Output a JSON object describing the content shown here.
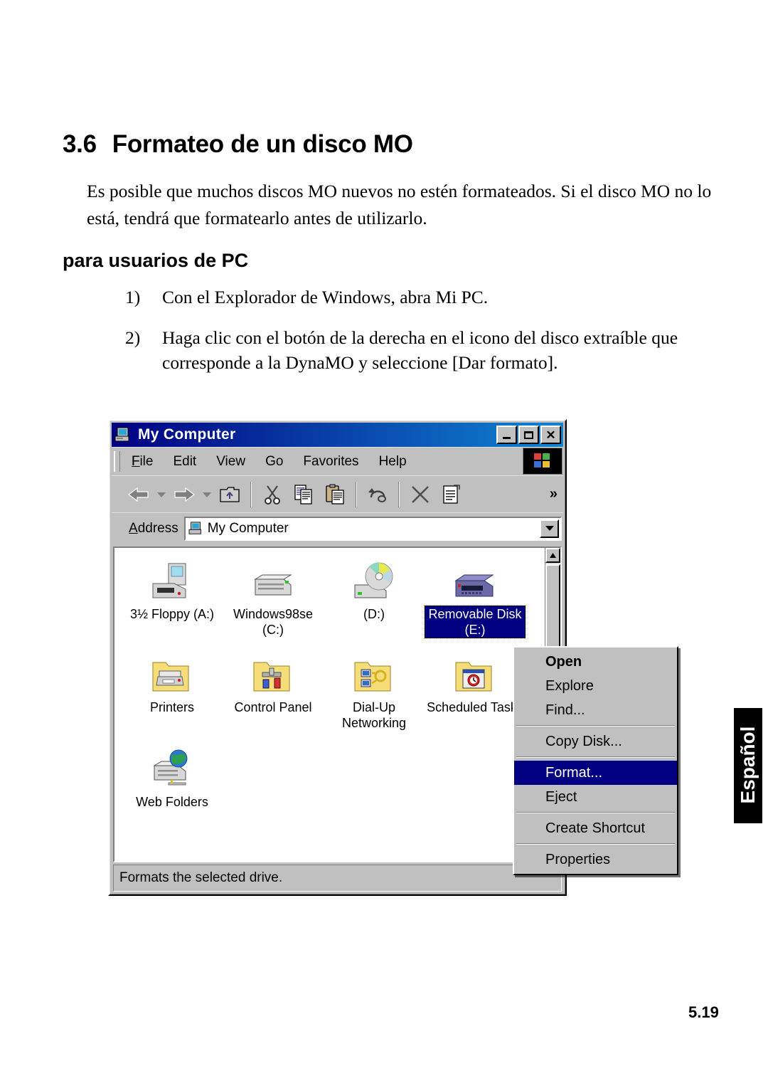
{
  "document": {
    "section_number": "3.6",
    "section_title": "Formateo de un disco MO",
    "intro_paragraph": "Es posible que muchos discos MO nuevos no estén formateados. Si el disco MO no lo está, tendrá que formatearlo antes de utilizarlo.",
    "subheading": "para usuarios de PC",
    "steps": [
      {
        "marker": "1)",
        "text": "Con el Explorador de Windows, abra Mi PC."
      },
      {
        "marker": "2)",
        "text": "Haga clic con el botón de la derecha en el icono del disco extraíble que corresponde a la DynaMO y seleccione [Dar formato]."
      }
    ],
    "language_tab": "Español",
    "page_number": "5.19"
  },
  "window": {
    "title": "My Computer",
    "title_icon": "my-computer-icon",
    "titlebar_buttons": [
      {
        "name": "minimize-button",
        "label": "_"
      },
      {
        "name": "maximize-button",
        "label": "□"
      },
      {
        "name": "close-button",
        "label": "✕"
      }
    ],
    "menu": [
      {
        "label": "File",
        "accel": "F"
      },
      {
        "label": "Edit",
        "accel": "E"
      },
      {
        "label": "View",
        "accel": "V"
      },
      {
        "label": "Go",
        "accel": "G"
      },
      {
        "label": "Favorites",
        "accel": "a"
      },
      {
        "label": "Help",
        "accel": "H"
      }
    ],
    "toolbar": [
      {
        "name": "back-button",
        "icon": "arrow-left-icon"
      },
      {
        "name": "back-dropdown",
        "icon": "caret-down-icon"
      },
      {
        "name": "forward-button",
        "icon": "arrow-right-icon"
      },
      {
        "name": "forward-dropdown",
        "icon": "caret-down-icon"
      },
      {
        "name": "up-button",
        "icon": "folder-up-icon"
      },
      {
        "name": "cut-button",
        "icon": "scissors-icon"
      },
      {
        "name": "copy-button",
        "icon": "copy-icon"
      },
      {
        "name": "paste-button",
        "icon": "clipboard-paste-icon"
      },
      {
        "name": "undo-button",
        "icon": "undo-arrow-icon"
      },
      {
        "name": "delete-button",
        "icon": "x-delete-icon"
      },
      {
        "name": "properties-button",
        "icon": "properties-icon"
      }
    ],
    "toolbar_overflow": "»",
    "address": {
      "label": "Address",
      "value": "My Computer",
      "icon": "my-computer-icon"
    },
    "items": [
      [
        {
          "label": "3½ Floppy (A:)",
          "icon": "floppy-drive-icon",
          "selected": false
        },
        {
          "label": "Windows98se (C:)",
          "icon": "hard-disk-icon",
          "selected": false
        },
        {
          "label": "(D:)",
          "icon": "cd-drive-icon",
          "selected": false
        },
        {
          "label": "Removable Disk (E:)",
          "icon": "removable-disk-icon",
          "selected": true
        }
      ],
      [
        {
          "label": "Printers",
          "icon": "printers-folder-icon",
          "selected": false
        },
        {
          "label": "Control Panel",
          "icon": "control-panel-folder-icon",
          "selected": false
        },
        {
          "label": "Dial-Up Networking",
          "icon": "dialup-folder-icon",
          "selected": false
        },
        {
          "label": "Scheduled Tasks",
          "icon": "scheduled-tasks-folder-icon",
          "selected": false
        }
      ],
      [
        {
          "label": "Web Folders",
          "icon": "web-folders-icon",
          "selected": false
        }
      ]
    ],
    "statusbar": "Formats the selected drive."
  },
  "context_menu": [
    {
      "label": "Open",
      "type": "item",
      "bold": true,
      "selected": false
    },
    {
      "label": "Explore",
      "type": "item",
      "bold": false,
      "selected": false
    },
    {
      "label": "Find...",
      "type": "item",
      "bold": false,
      "selected": false
    },
    {
      "label": "",
      "type": "separator"
    },
    {
      "label": "Copy Disk...",
      "type": "item",
      "bold": false,
      "selected": false
    },
    {
      "label": "",
      "type": "separator"
    },
    {
      "label": "Format...",
      "type": "item",
      "bold": false,
      "selected": true
    },
    {
      "label": "Eject",
      "type": "item",
      "bold": false,
      "selected": false
    },
    {
      "label": "",
      "type": "separator"
    },
    {
      "label": "Create Shortcut",
      "type": "item",
      "bold": false,
      "selected": false
    },
    {
      "label": "",
      "type": "separator"
    },
    {
      "label": "Properties",
      "type": "item",
      "bold": false,
      "selected": false
    }
  ],
  "colors": {
    "titlebar_start": "#000082",
    "titlebar_end": "#1084d0",
    "face": "#c0c0c0",
    "selection": "#000080",
    "lang_tab_bg": "#000000"
  }
}
